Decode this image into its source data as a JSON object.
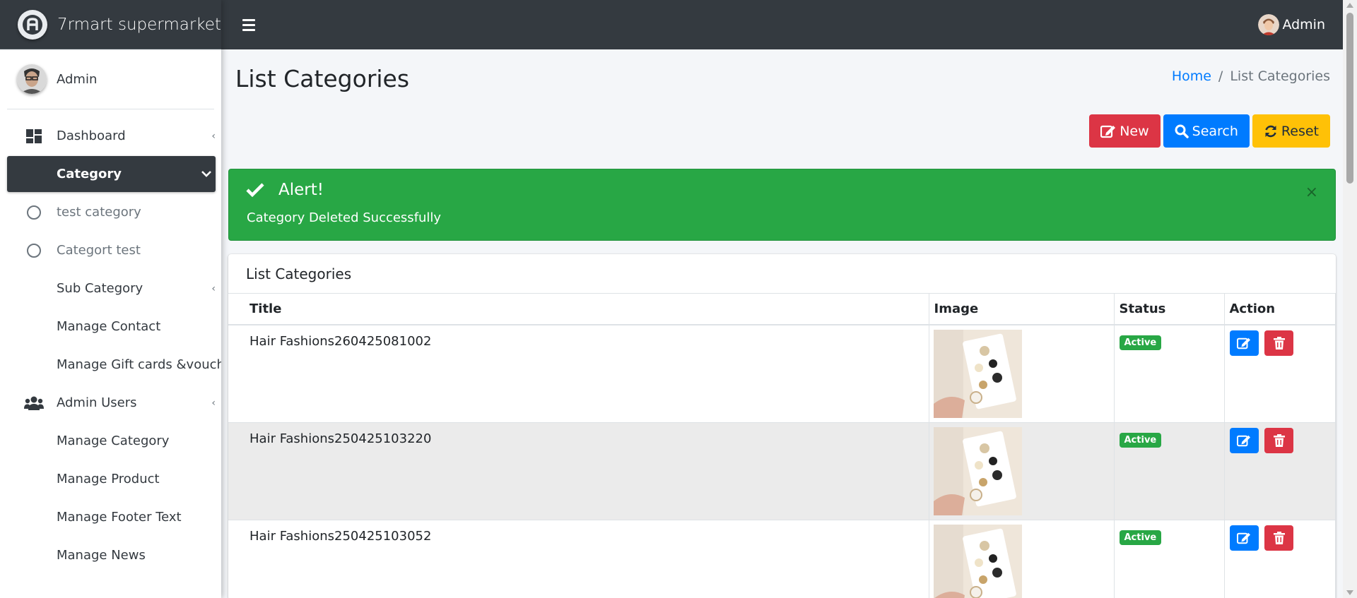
{
  "brand": {
    "name": "7rmart supermarket"
  },
  "sidebar": {
    "user_name": "Admin",
    "items": [
      {
        "label": "Dashboard",
        "icon": "dashboard-icon",
        "caret": "‹"
      },
      {
        "label": "Category",
        "caret": "⌄"
      },
      {
        "label": "test category",
        "icon": "circle-icon"
      },
      {
        "label": "Categort test",
        "icon": "circle-icon"
      },
      {
        "label": "Sub Category",
        "caret": "‹"
      },
      {
        "label": "Manage Contact"
      },
      {
        "label": "Manage Gift cards &voucher"
      },
      {
        "label": "Admin Users",
        "icon": "users-icon",
        "caret": "‹"
      },
      {
        "label": "Manage Category"
      },
      {
        "label": "Manage Product"
      },
      {
        "label": "Manage Footer Text"
      },
      {
        "label": "Manage News"
      }
    ]
  },
  "topbar": {
    "user_name": "Admin"
  },
  "page": {
    "title": "List Categories",
    "breadcrumb": {
      "home": "Home",
      "separator": "/",
      "current": "List Categories"
    }
  },
  "buttons": {
    "new": "New",
    "search": "Search",
    "reset": "Reset"
  },
  "alert": {
    "title": "Alert!",
    "message": "Category Deleted Successfully",
    "close": "×"
  },
  "card": {
    "title": "List Categories",
    "columns": {
      "title": "Title",
      "image": "Image",
      "status": "Status",
      "action": "Action"
    },
    "rows": [
      {
        "title": "Hair Fashions260425081002",
        "status": "Active"
      },
      {
        "title": "Hair Fashions250425103220",
        "status": "Active"
      },
      {
        "title": "Hair Fashions250425103052",
        "status": "Active"
      }
    ]
  },
  "colors": {
    "dark": "#343a40",
    "primary": "#007bff",
    "danger": "#dc3545",
    "warning": "#ffc107",
    "success": "#28a745"
  }
}
